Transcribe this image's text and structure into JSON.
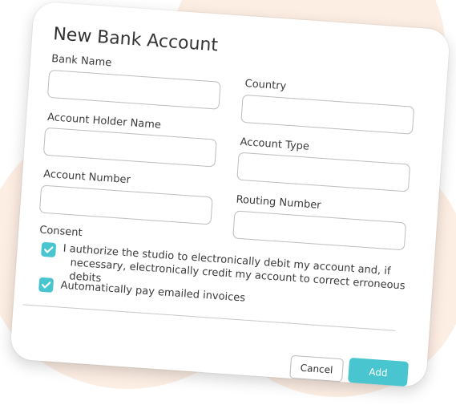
{
  "dialog": {
    "title": "New Bank Account"
  },
  "fields": {
    "bank_name": {
      "label": "Bank Name",
      "value": ""
    },
    "country": {
      "label": "Country",
      "value": ""
    },
    "account_holder_name": {
      "label": "Account Holder Name",
      "value": ""
    },
    "account_type": {
      "label": "Account Type",
      "value": ""
    },
    "account_number": {
      "label": "Account Number",
      "value": ""
    },
    "routing_number": {
      "label": "Routing Number",
      "value": ""
    }
  },
  "consent": {
    "label": "Consent",
    "authorize": {
      "checked": true,
      "line1": "I authorize the studio to electronically debit my account and, if",
      "line2": "necessary, electronically credit my account to correct erroneous debits"
    },
    "autopay": {
      "checked": true,
      "text": "Automatically pay emailed invoices"
    }
  },
  "actions": {
    "cancel_label": "Cancel",
    "add_label": "Add"
  },
  "colors": {
    "accent": "#48c5cf",
    "background_shape": "#fdeee3"
  }
}
